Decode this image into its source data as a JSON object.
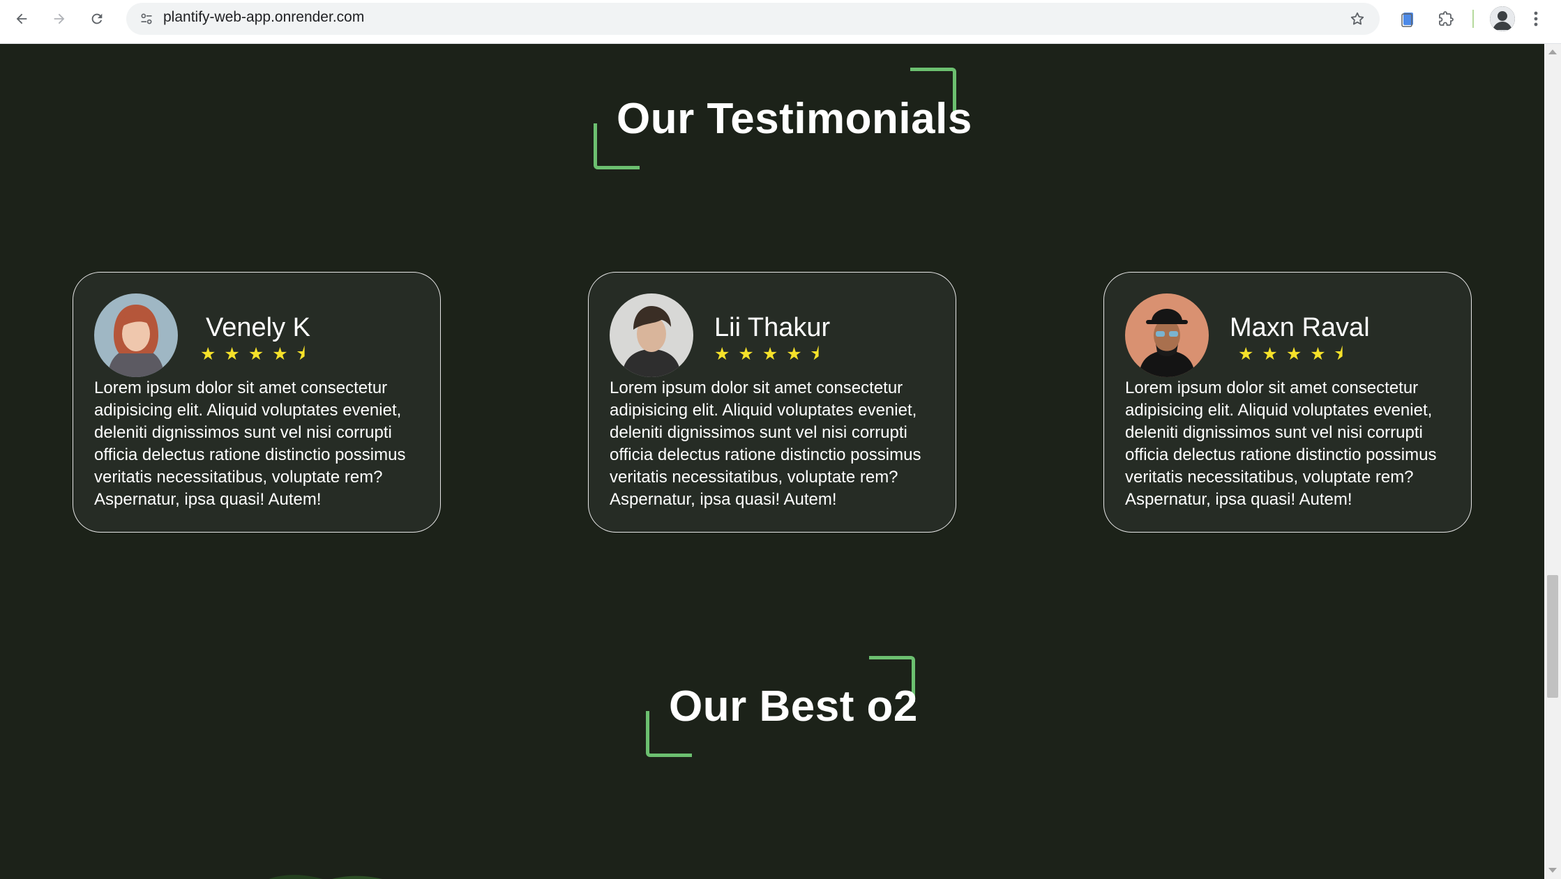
{
  "browser": {
    "url": "plantify-web-app.onrender.com"
  },
  "sections": {
    "testimonials_title": "Our Testimonials",
    "best_title": "Our Best o2"
  },
  "testimonials": [
    {
      "name": "Venely K",
      "rating": 4.5,
      "stars": "★★★★⯨",
      "text": "Lorem ipsum dolor sit amet consectetur adipisicing elit. Aliquid voluptates eveniet, deleniti dignissimos sunt vel nisi corrupti officia delectus ratione distinctio possimus veritatis necessitatibus, voluptate rem? Aspernatur, ipsa quasi! Autem!"
    },
    {
      "name": "Lii Thakur",
      "rating": 4.5,
      "stars": "★★★★⯨",
      "text": "Lorem ipsum dolor sit amet consectetur adipisicing elit. Aliquid voluptates eveniet, deleniti dignissimos sunt vel nisi corrupti officia delectus ratione distinctio possimus veritatis necessitatibus, voluptate rem? Aspernatur, ipsa quasi! Autem!"
    },
    {
      "name": "Maxn Raval",
      "rating": 4.5,
      "stars": "★★★★⯨",
      "text": "Lorem ipsum dolor sit amet consectetur adipisicing elit. Aliquid voluptates eveniet, deleniti dignissimos sunt vel nisi corrupti officia delectus ratione distinctio possimus veritatis necessitatibus, voluptate rem? Aspernatur, ipsa quasi! Autem!"
    }
  ],
  "colors": {
    "background": "#1c2219",
    "card": "#262c25",
    "accent_green": "#6cc070",
    "star": "#f5e12a"
  }
}
